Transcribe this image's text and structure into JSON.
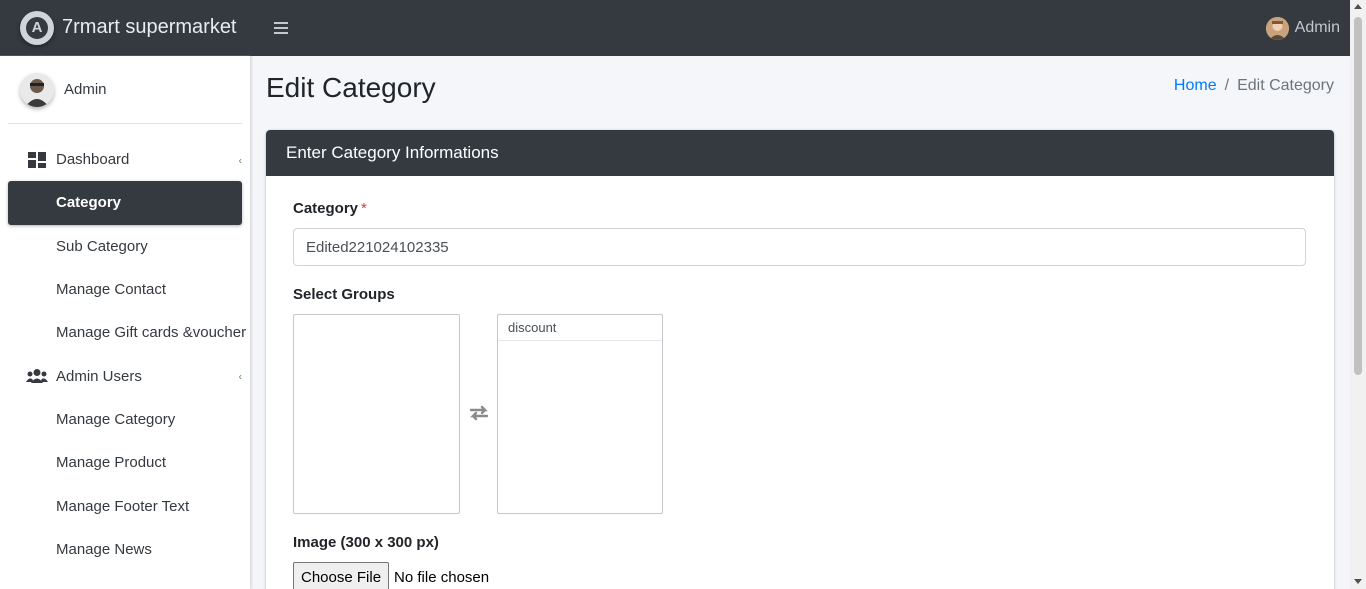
{
  "brand": {
    "name": "7rmart supermarket",
    "logo_icon": "brand-logo-icon"
  },
  "sidebar": {
    "user_name": "Admin",
    "items": [
      {
        "label": "Dashboard",
        "icon": "dashboard-icon",
        "has_angle": true
      },
      {
        "label": "Category",
        "active": true
      },
      {
        "label": "Sub Category"
      },
      {
        "label": "Manage Contact"
      },
      {
        "label": "Manage Gift cards &voucher"
      },
      {
        "label": "Admin Users",
        "icon": "users-icon",
        "has_angle": true
      },
      {
        "label": "Manage Category"
      },
      {
        "label": "Manage Product"
      },
      {
        "label": "Manage Footer Text"
      },
      {
        "label": "Manage News"
      }
    ]
  },
  "topbar": {
    "user_name": "Admin",
    "menu_icon": "hamburger-menu-icon"
  },
  "page": {
    "title": "Edit Category",
    "breadcrumb": {
      "home": "Home",
      "separator": "/",
      "current": "Edit Category"
    }
  },
  "form": {
    "card_title": "Enter Category Informations",
    "category_label": "Category",
    "required_mark": "*",
    "category_value": "Edited221024102335",
    "groups_label": "Select Groups",
    "available_groups": [],
    "selected_groups": [
      "discount"
    ],
    "image_label": "Image (300 x 300 px)",
    "file_button": "Choose File",
    "file_status": "No file chosen"
  },
  "colors": {
    "dark": "#343a40",
    "accent_link": "#007bff",
    "required": "#dc3545",
    "background": "#f4f6f9"
  }
}
